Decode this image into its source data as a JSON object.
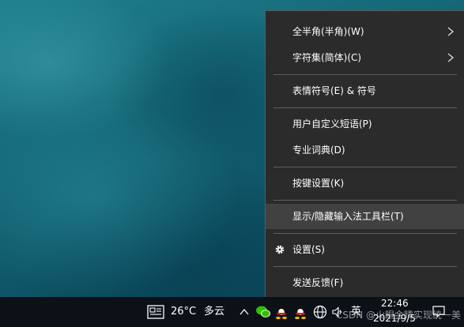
{
  "menu": {
    "items": [
      {
        "label": "全半角(半角)(W)",
        "submenu": true
      },
      {
        "label": "字符集(简体)(C)",
        "submenu": true
      },
      {
        "label": "表情符号(E) & 符号"
      },
      {
        "label": "用户自定义短语(P)"
      },
      {
        "label": "专业词典(D)"
      },
      {
        "label": "按键设置(K)"
      },
      {
        "label": "显示/隐藏输入法工具栏(T)",
        "highlighted": true
      },
      {
        "label": "设置(S)",
        "icon": "gear-icon"
      },
      {
        "label": "发送反馈(F)"
      }
    ]
  },
  "taskbar": {
    "news_icon": "news-icon",
    "temperature": "26°C",
    "weather": "多云",
    "tray_icons": [
      "chevron-up-icon",
      "wechat-icon",
      "qq-icon",
      "qq-icon",
      "globe-icon",
      "speaker-icon"
    ],
    "ime_indicator": "英",
    "time": "22:46",
    "date": "2021/9/5",
    "notification_icon": "notification-icon"
  },
  "watermark": "CSDN @火眼金睛实现统一美",
  "colors": {
    "menu_bg": "#2b2b2b",
    "menu_highlight": "#414141",
    "menu_border": "#5a5a5a",
    "taskbar_bg": "#0b1117",
    "text": "#ffffff"
  }
}
